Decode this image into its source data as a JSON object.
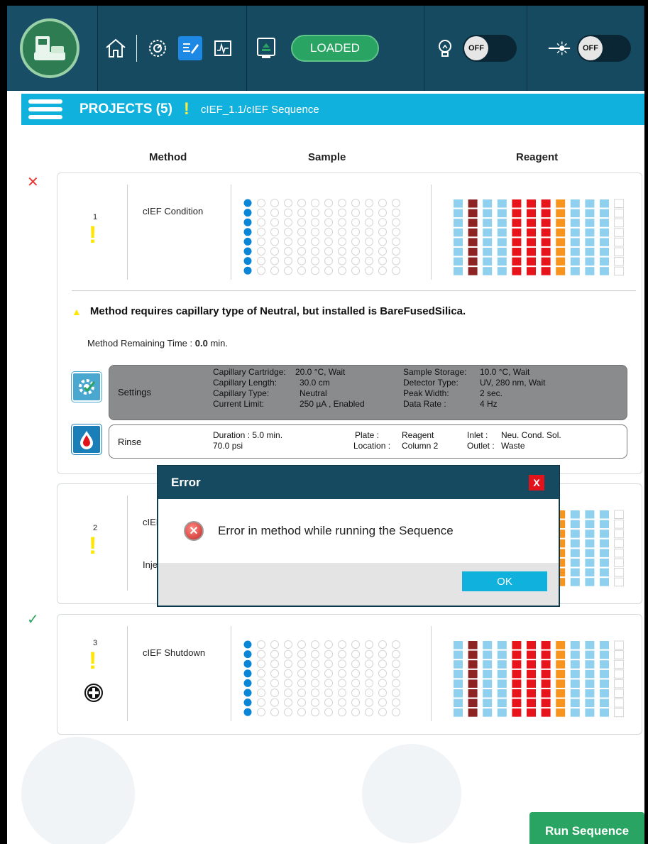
{
  "topbar": {
    "loaded_label": "LOADED",
    "lamp_toggle": "OFF",
    "laser_toggle": "OFF"
  },
  "projects": {
    "title": "PROJECTS (5)",
    "warn": "!",
    "path": "cIEF_1.1/cIEF Sequence"
  },
  "columns": {
    "method": "Method",
    "sample": "Sample",
    "reagent": "Reagent"
  },
  "card1": {
    "status": "✕",
    "number": "1",
    "warn": "!",
    "method": "cIEF Condition",
    "warning": "Method requires capillary type of Neutral, but installed is BareFusedSilica.",
    "remaining_label": "Method Remaining Time :",
    "remaining_value": "0.0",
    "remaining_unit": "min.",
    "settings": {
      "label": "Settings",
      "cartridge_label": "Capillary Cartridge:",
      "cartridge_value": "20.0 °C, Wait",
      "length_label": "Capillary Length:",
      "length_value": "30.0 cm",
      "type_label": "Capillary Type:",
      "type_value": "Neutral",
      "current_label": "Current Limit:",
      "current_value": "250 µA , Enabled",
      "storage_label": "Sample Storage:",
      "storage_value": "10.0 °C, Wait",
      "detector_label": "Detector Type:",
      "detector_value": "UV, 280 nm, Wait",
      "peak_label": "Peak Width:",
      "peak_value": "2 sec.",
      "rate_label": "Data Rate :",
      "rate_value": "4 Hz"
    },
    "rinse": {
      "label": "Rinse",
      "duration": "Duration : 5.0 min.",
      "pressure": "70.0 psi",
      "plate_label": "Plate :",
      "plate_value": "Reagent",
      "location_label": "Location :",
      "location_value": "Column 2",
      "inlet_label": "Inlet :",
      "inlet_value": "Neu. Cond. Sol.",
      "outlet_label": "Outlet :",
      "outlet_value": "Waste"
    }
  },
  "card2": {
    "number": "2",
    "warn": "!",
    "method_partial": "cIEF",
    "inject_partial": "Inje"
  },
  "card3": {
    "status": "✓",
    "number": "3",
    "warn": "!",
    "method": "cIEF Shutdown"
  },
  "dialog": {
    "title": "Error",
    "close": "X",
    "message": "Error in method while running the Sequence",
    "ok": "OK"
  },
  "run_button": "Run Sequence",
  "colors": {
    "topbar": "#164a60",
    "projbar": "#10b1dd",
    "loaded": "#2aa462",
    "reagent_light_blue": "#8fd0ef",
    "reagent_dark_red": "#8e2323",
    "reagent_red": "#e8141c",
    "reagent_orange": "#f7941d",
    "sample_dot": "#0a86d6"
  },
  "reagent_columns": [
    "lb",
    "dr",
    "lb",
    "lb",
    "r",
    "r",
    "r",
    "o",
    "lb",
    "lb",
    "lb",
    "e"
  ]
}
